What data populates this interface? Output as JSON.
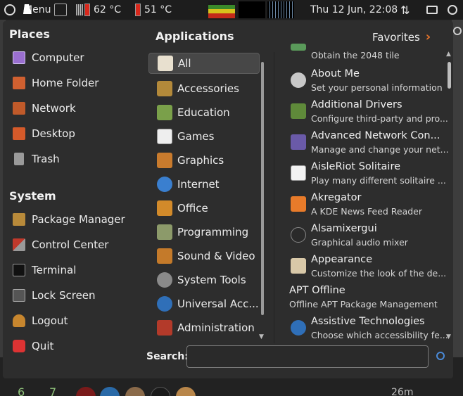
{
  "panel": {
    "menu_label": "Menu",
    "cpu_temp": "62 °C",
    "gpu_temp": "51 °C",
    "clock": "Thu 12 Jun, 22:08"
  },
  "places": {
    "title": "Places",
    "items": [
      {
        "label": "Computer",
        "icon": "computer-icon"
      },
      {
        "label": "Home Folder",
        "icon": "home-folder-icon"
      },
      {
        "label": "Network",
        "icon": "network-icon"
      },
      {
        "label": "Desktop",
        "icon": "desktop-icon"
      },
      {
        "label": "Trash",
        "icon": "trash-icon"
      }
    ]
  },
  "system": {
    "title": "System",
    "items": [
      {
        "label": "Package Manager",
        "icon": "package-manager-icon"
      },
      {
        "label": "Control Center",
        "icon": "control-center-icon"
      },
      {
        "label": "Terminal",
        "icon": "terminal-icon"
      },
      {
        "label": "Lock Screen",
        "icon": "lock-screen-icon"
      },
      {
        "label": "Logout",
        "icon": "logout-icon"
      },
      {
        "label": "Quit",
        "icon": "quit-icon"
      }
    ]
  },
  "applications": {
    "title": "Applications",
    "favorites": "Favorites",
    "categories": [
      {
        "label": "All"
      },
      {
        "label": "Accessories"
      },
      {
        "label": "Education"
      },
      {
        "label": "Games"
      },
      {
        "label": "Graphics"
      },
      {
        "label": "Internet"
      },
      {
        "label": "Office"
      },
      {
        "label": "Programming"
      },
      {
        "label": "Sound & Video"
      },
      {
        "label": "System Tools"
      },
      {
        "label": "Universal Acc..."
      },
      {
        "label": "Administration"
      }
    ],
    "apps": [
      {
        "name": "",
        "desc": "Obtain the 2048 tile"
      },
      {
        "name": "About Me",
        "desc": "Set your personal information"
      },
      {
        "name": "Additional Drivers",
        "desc": "Configure third-party and pro..."
      },
      {
        "name": "Advanced Network Con...",
        "desc": "Manage and change your net..."
      },
      {
        "name": "AisleRiot Solitaire",
        "desc": "Play many different solitaire ..."
      },
      {
        "name": "Akregator",
        "desc": "A KDE News Feed Reader"
      },
      {
        "name": "Alsamixergui",
        "desc": "Graphical audio mixer"
      },
      {
        "name": "Appearance",
        "desc": "Customize the look of the de..."
      },
      {
        "name": "APT Offline",
        "desc": "Offline APT Package Management"
      },
      {
        "name": "Assistive Technologies",
        "desc": "Choose which accessibility fe..."
      }
    ]
  },
  "search": {
    "label": "Search:",
    "placeholder": ""
  },
  "bottom": {
    "ws6": "6",
    "ws7": "7",
    "uptime": "26m"
  }
}
